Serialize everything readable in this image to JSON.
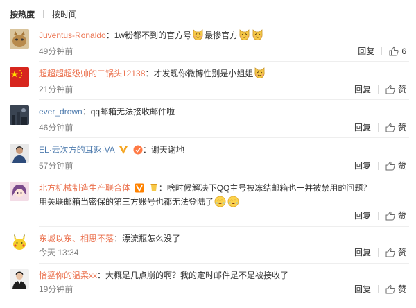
{
  "tabs": [
    {
      "label": "按热度",
      "active": true
    },
    {
      "label": "按时间",
      "active": false
    }
  ],
  "reply_label": "回复",
  "comments": [
    {
      "user": "Juventus-Ronaldo",
      "text_a": "1w粉都不到的官方号",
      "text_b": "最惨官方",
      "time": "49分钟前",
      "like_count": "6",
      "avatar": "avatar-cat"
    },
    {
      "user": "超超超超级帅的二锅头12138",
      "text_a": "才发现你微博性别是小姐姐",
      "time": "21分钟前",
      "like_label": "赞",
      "avatar": "avatar-flag"
    },
    {
      "user": "ever_drown",
      "text_a": "qq邮箱无法接收邮件啦",
      "time": "46分钟前",
      "like_label": "赞",
      "avatar": "avatar-city"
    },
    {
      "user": "EL·云次方的耳返·VA",
      "text_a": "谢天谢地",
      "time": "57分钟前",
      "like_label": "赞",
      "avatar": "avatar-person"
    },
    {
      "user": "北方机械制造生产联合体",
      "text_a": "啥时候解决下QQ主号被冻结邮箱也一并被禁用的问题？用关联",
      "text_b": "邮箱当密保的第三方账号也都无法登陆了",
      "time": "",
      "like_label": "赞",
      "avatar": "avatar-anime"
    },
    {
      "user": "东城以东、相思不落",
      "text_a": "漂流瓶怎么没了",
      "time": "今天 13:34",
      "like_label": "赞",
      "avatar": "avatar-pikachu"
    },
    {
      "user": "恰鎏你的温柔xx",
      "text_a": "大概是几点崩的啊？我的定时邮件是不是被接收了",
      "time": "19分钟前",
      "like_label": "赞",
      "avatar": "avatar-man"
    }
  ],
  "colors": {
    "username": "#eb7350",
    "username_alt": "#507daf",
    "time": "#808080"
  }
}
